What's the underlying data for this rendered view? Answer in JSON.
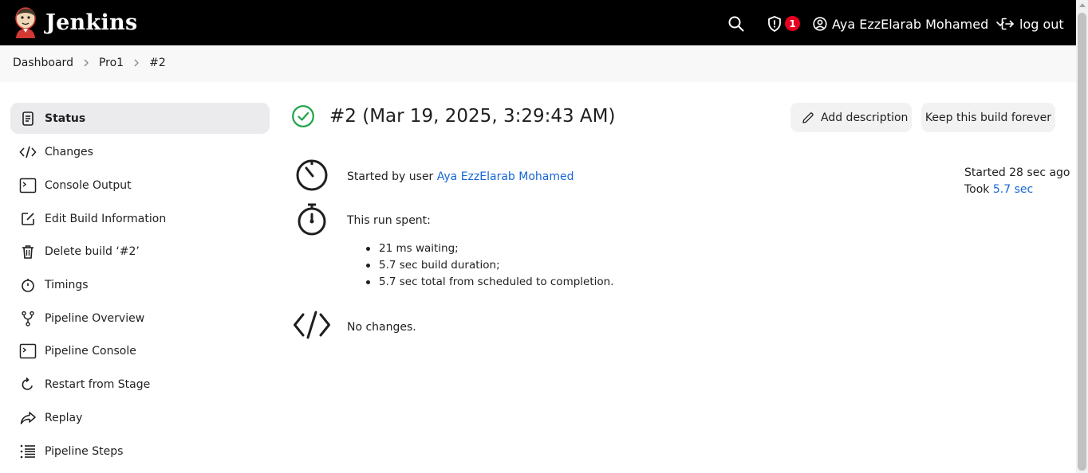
{
  "header": {
    "app_name": "Jenkins",
    "security_count": "1",
    "user_name": "Aya EzzElarab Mohamed",
    "logout_label": "log out"
  },
  "breadcrumb": [
    "Dashboard",
    "Pro1",
    "#2"
  ],
  "sidebar": {
    "items": [
      {
        "label": "Status",
        "icon": "document-icon"
      },
      {
        "label": "Changes",
        "icon": "code-icon"
      },
      {
        "label": "Console Output",
        "icon": "terminal-icon"
      },
      {
        "label": "Edit Build Information",
        "icon": "edit-icon"
      },
      {
        "label": "Delete build ‘#2’",
        "icon": "trash-icon"
      },
      {
        "label": "Timings",
        "icon": "stopwatch-icon"
      },
      {
        "label": "Pipeline Overview",
        "icon": "branch-icon"
      },
      {
        "label": "Pipeline Console",
        "icon": "terminal-icon"
      },
      {
        "label": "Restart from Stage",
        "icon": "restart-icon"
      },
      {
        "label": "Replay",
        "icon": "replay-icon"
      },
      {
        "label": "Pipeline Steps",
        "icon": "list-icon"
      }
    ]
  },
  "build": {
    "title": "#2 (Mar 19, 2025, 3:29:43 AM)",
    "add_description_label": "Add description",
    "keep_forever_label": "Keep this build forever",
    "started_by_prefix": "Started by user ",
    "started_by_user": "Aya EzzElarab Mohamed",
    "run_spent_label": "This run spent:",
    "spent_items": [
      "21 ms waiting;",
      "5.7 sec build duration;",
      "5.7 sec total from scheduled to completion."
    ],
    "no_changes": "No changes.",
    "started_ago": "Started 28 sec ago",
    "took_prefix": "Took ",
    "took_value": "5.7 sec"
  },
  "colors": {
    "header_bg": "#000000",
    "success_green": "#1ea446",
    "link_blue": "#1766d6",
    "badge_red": "#e6001f"
  }
}
